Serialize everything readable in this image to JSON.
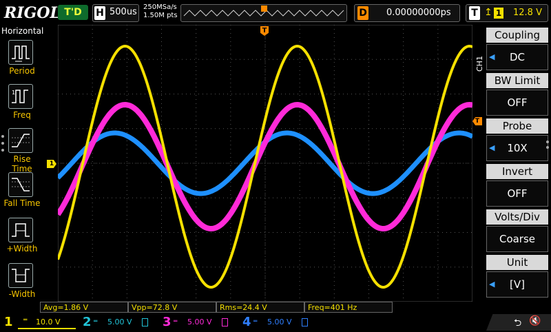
{
  "topbar": {
    "brand": "RIGOL",
    "run_status": "T'D",
    "timebase_key": "H",
    "timebase_value": "500us",
    "sample_rate": "250MSa/s",
    "memory_depth": "1.50M pts",
    "delay_key": "D",
    "delay_value": "0.00000000ps",
    "trigger_key": "T",
    "trigger_source": "1",
    "trigger_level": "12.8 V"
  },
  "left_menu": {
    "title": "Horizontal",
    "items": [
      {
        "label": "Period",
        "icon": "period-icon"
      },
      {
        "label": "Freq",
        "icon": "freq-icon"
      },
      {
        "label": "Rise Time",
        "icon": "rise-time-icon"
      },
      {
        "label": "Fall Time",
        "icon": "fall-time-icon"
      },
      {
        "label": "+Width",
        "icon": "positive-width-icon"
      },
      {
        "label": "-Width",
        "icon": "negative-width-icon"
      }
    ]
  },
  "right_menu": {
    "channel_tag": "CH1",
    "items": [
      {
        "title": "Coupling",
        "value": "DC",
        "arrow": true
      },
      {
        "title": "BW Limit",
        "value": "OFF",
        "arrow": false
      },
      {
        "title": "Probe",
        "value": "10X",
        "arrow": true
      },
      {
        "title": "Invert",
        "value": "OFF",
        "arrow": false
      },
      {
        "title": "Volts/Div",
        "value": "Coarse",
        "arrow": false
      },
      {
        "title": "Unit",
        "value": "[V]",
        "arrow": true
      }
    ]
  },
  "measurements": {
    "avg": "Avg=1.86 V",
    "vpp": "Vpp=72.8 V",
    "rms": "Rms=24.4 V",
    "freq": "Freq=401 Hz"
  },
  "channels": [
    {
      "num": "1",
      "scale": "10.0 V",
      "color": "#f5e000"
    },
    {
      "num": "2",
      "scale": "5.00 V",
      "color": "#22c4d8"
    },
    {
      "num": "3",
      "scale": "5.00 V",
      "color": "#ff2ad8"
    },
    {
      "num": "4",
      "scale": "5.00 V",
      "color": "#2f7fff"
    }
  ],
  "colors": {
    "ch1": "#f5e000",
    "ch3": "#ff2ad8",
    "ch4": "#1e90ff",
    "trigger": "#ff8a00",
    "grid": "#555555"
  },
  "markers": {
    "ch1_ground": "1",
    "trigger_level_marker": "T",
    "time_marker": "T"
  }
}
